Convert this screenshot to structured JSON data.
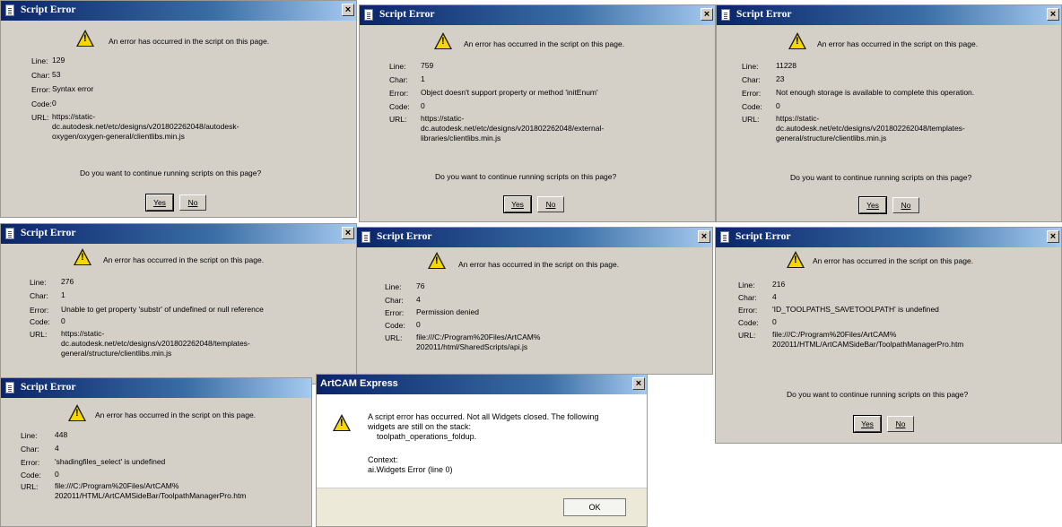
{
  "dialogs": [
    {
      "title": "Script Error",
      "message": "An error has occurred in the script on this page.",
      "labels": {
        "line": "Line:",
        "char": "Char:",
        "error": "Error:",
        "code": "Code:",
        "url": "URL:"
      },
      "line": "129",
      "char": "53",
      "error": "Syntax error",
      "code": "0",
      "url": [
        "https://static-",
        "dc.autodesk.net/etc/designs/v201802262048/autodesk-",
        "oxygen/oxygen-general/clientlibs.min.js"
      ],
      "question": "Do you want to continue running scripts on this page?",
      "yes": "Yes",
      "no": "No"
    },
    {
      "title": "Script Error",
      "message": "An error has occurred in the script on this page.",
      "labels": {
        "line": "Line:",
        "char": "Char:",
        "error": "Error:",
        "code": "Code:",
        "url": "URL:"
      },
      "line": "759",
      "char": "1",
      "error": "Object doesn't support property or method 'initEnum'",
      "code": "0",
      "url": [
        "https://static-",
        "dc.autodesk.net/etc/designs/v201802262048/external-",
        "libraries/clientlibs.min.js"
      ],
      "question": "Do you want to continue running scripts on this page?",
      "yes": "Yes",
      "no": "No"
    },
    {
      "title": "Script Error",
      "message": "An error has occurred in the script on this page.",
      "labels": {
        "line": "Line:",
        "char": "Char:",
        "error": "Error:",
        "code": "Code:",
        "url": "URL:"
      },
      "line": "11228",
      "char": "23",
      "error": "Not enough storage is available to complete this operation.",
      "code": "0",
      "url": [
        "https://static-",
        "dc.autodesk.net/etc/designs/v201802262048/templates-",
        "general/structure/clientlibs.min.js"
      ],
      "question": "Do you want to continue running scripts on this page?",
      "yes": "Yes",
      "no": "No"
    },
    {
      "title": "Script Error",
      "message": "An error has occurred in the script on this page.",
      "labels": {
        "line": "Line:",
        "char": "Char:",
        "error": "Error:",
        "code": "Code:",
        "url": "URL:"
      },
      "line": "276",
      "char": "1",
      "error": "Unable to get property 'substr' of undefined or null reference",
      "code": "0",
      "url": [
        "https://static-",
        "dc.autodesk.net/etc/designs/v201802262048/templates-",
        "general/structure/clientlibs.min.js"
      ]
    },
    {
      "title": "Script Error",
      "message": "An error has occurred in the script on this page.",
      "labels": {
        "line": "Line:",
        "char": "Char:",
        "error": "Error:",
        "code": "Code:",
        "url": "URL:"
      },
      "line": "76",
      "char": "4",
      "error": "Permission denied",
      "code": "0",
      "url": [
        "file:///C:/Program%20Files/ArtCAM%",
        "202011/html/SharedScripts/api.js"
      ]
    },
    {
      "title": "Script Error",
      "message": "An error has occurred in the script on this page.",
      "labels": {
        "line": "Line:",
        "char": "Char:",
        "error": "Error:",
        "code": "Code:",
        "url": "URL:"
      },
      "line": "216",
      "char": "4",
      "error": "'ID_TOOLPATHS_SAVETOOLPATH' is undefined",
      "code": "0",
      "url": [
        "file:///C:/Program%20Files/ArtCAM%",
        "202011/HTML/ArtCAMSideBar/ToolpathManagerPro.htm"
      ],
      "question": "Do you want to continue running scripts on this page?",
      "yes": "Yes",
      "no": "No"
    },
    {
      "title": "Script Error",
      "message": "An error has occurred in the script on this page.",
      "labels": {
        "line": "Line:",
        "char": "Char:",
        "error": "Error:",
        "code": "Code:",
        "url": "URL:"
      },
      "line": "448",
      "char": "4",
      "error": "'shadingfiles_select' is undefined",
      "code": "0",
      "url": [
        "file:///C:/Program%20Files/ArtCAM%",
        "202011/HTML/ArtCAMSideBar/ToolpathManagerPro.htm"
      ]
    }
  ],
  "artcam": {
    "title": "ArtCAM Express",
    "message": [
      "A script error has occurred. Not all Widgets closed. The following",
      "widgets are still on the stack:",
      "    toolpath_operations_foldup."
    ],
    "context_label": "Context:",
    "context_value": "ai.Widgets Error (line 0)",
    "ok": "OK"
  },
  "close_glyph": "×",
  "warning_glyph": "!"
}
